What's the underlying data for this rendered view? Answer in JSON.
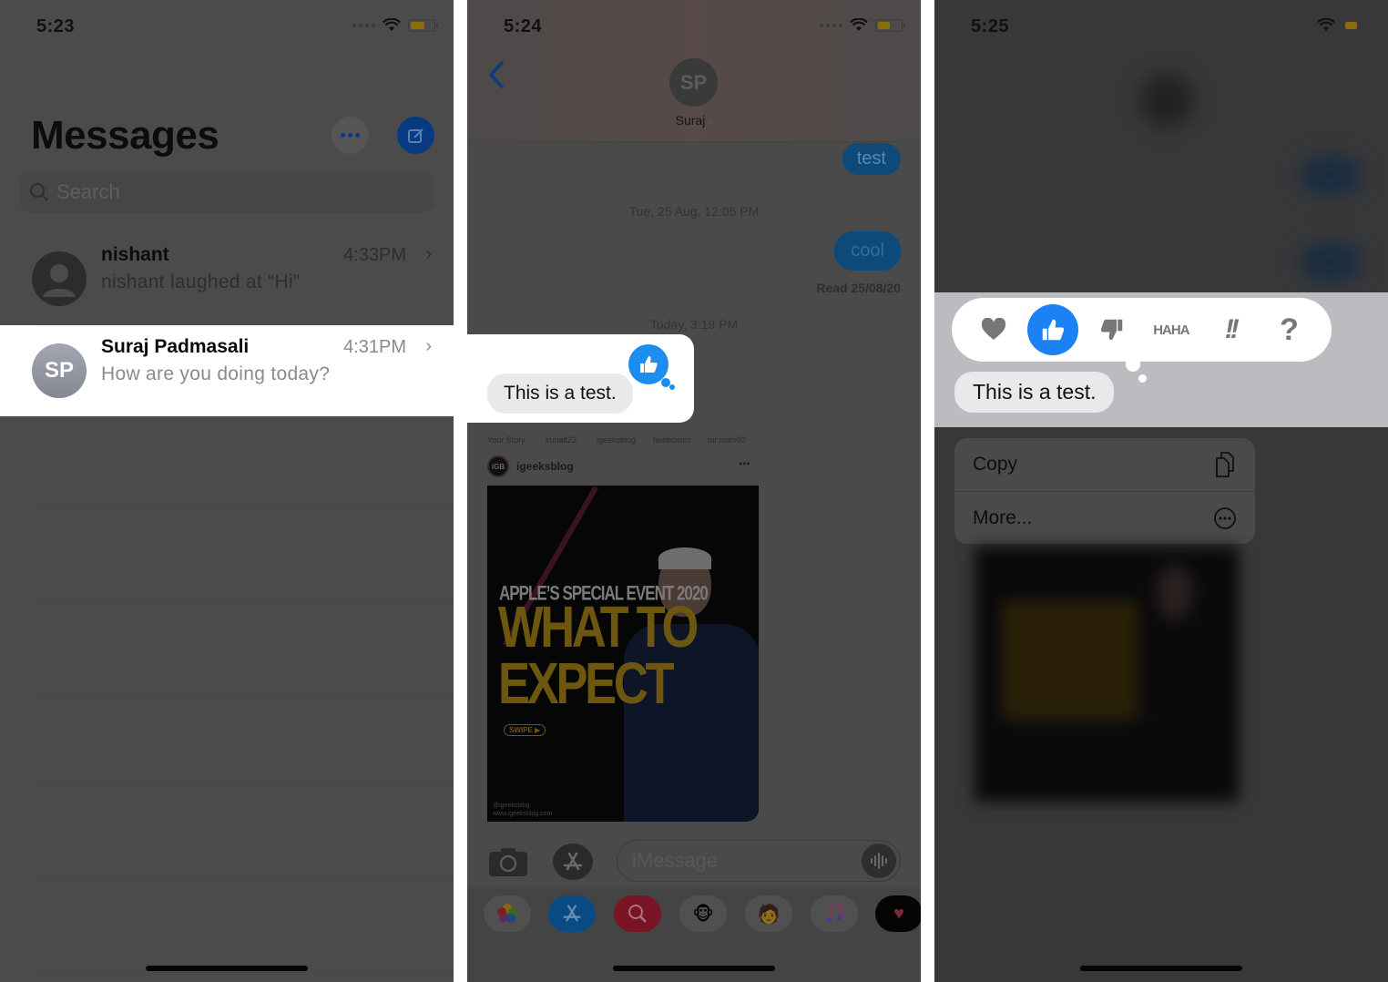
{
  "panels": [
    {
      "status": {
        "time": "5:23"
      },
      "header": {
        "title": "Messages",
        "more_icon": "ellipsis-icon",
        "compose_icon": "compose-icon"
      },
      "search": {
        "placeholder": "Search"
      },
      "conversations": [
        {
          "name": "nishant",
          "preview": "nishant laughed at “Hi”",
          "time": "4:33PM",
          "avatar": "person-icon",
          "highlighted": false
        },
        {
          "name": "Suraj Padmasali",
          "preview": "How are you doing today?",
          "time": "4:31PM",
          "avatar_initials": "SP",
          "highlighted": true
        }
      ]
    },
    {
      "status": {
        "time": "5:24"
      },
      "header": {
        "back_icon": "chevron-left-icon",
        "contact_initials": "SP",
        "contact_name": "Suraj",
        "contact_chevron": "›"
      },
      "messages": [
        {
          "type": "outgoing",
          "text": "test"
        },
        {
          "type": "timestamp",
          "text": "Tue, 25 Aug, 12:05 PM"
        },
        {
          "type": "outgoing",
          "text": "cool"
        },
        {
          "type": "receipt",
          "text": "Read 25/08/20"
        },
        {
          "type": "timestamp",
          "text": "Today, 3:19 PM"
        },
        {
          "type": "incoming",
          "text": "This is a test.",
          "tapback": "thumbs-up"
        }
      ],
      "shared_post": {
        "stories": [
          "Your Story",
          "kunalt22",
          "igeeksblog",
          "beebomco",
          "mr.mahi92"
        ],
        "username": "igeeksblog",
        "logo_text": "iGB",
        "more": "•••",
        "headline_small": "APPLE’S SPECIAL EVENT 2020",
        "headline_big_1": "WHAT TO",
        "headline_big_2": "EXPECT",
        "swipe_label": "SWIPE ▶",
        "credit_1": "@igeeksblog",
        "credit_2": "www.igeeksblog.com"
      },
      "composer": {
        "camera_icon": "camera-icon",
        "apps_icon": "app-store-icon",
        "placeholder": "iMessage",
        "audio_icon": "waveform-icon"
      },
      "app_drawer": [
        "photos-icon",
        "app-store-icon",
        "web-search-icon",
        "animoji-monkey-icon",
        "memoji-icon",
        "music-icon",
        "digital-touch-icon"
      ]
    },
    {
      "status": {
        "time": "5:25"
      },
      "tapbacks": [
        {
          "name": "heart",
          "label": "♥",
          "selected": false
        },
        {
          "name": "thumbs-up",
          "label": "👍",
          "selected": true
        },
        {
          "name": "thumbs-down",
          "label": "👎",
          "selected": false
        },
        {
          "name": "haha",
          "label": "HA HA",
          "line1": "HA",
          "line2": "HA",
          "selected": false
        },
        {
          "name": "exclamation",
          "label": "!!",
          "selected": false
        },
        {
          "name": "question",
          "label": "?",
          "selected": false
        }
      ],
      "message": "This is a test.",
      "context_menu": [
        {
          "label": "Copy",
          "icon": "copy-icon"
        },
        {
          "label": "More...",
          "icon": "ellipsis-circle-icon"
        }
      ]
    }
  ],
  "colors": {
    "ios_blue": "#1a82f5",
    "tapback_blue": "#1d8ef0",
    "dimmed_blue": "#083a82",
    "incoming_bubble": "#e9e9eb",
    "outgoing_bubble_dim": "#0e4a79"
  }
}
